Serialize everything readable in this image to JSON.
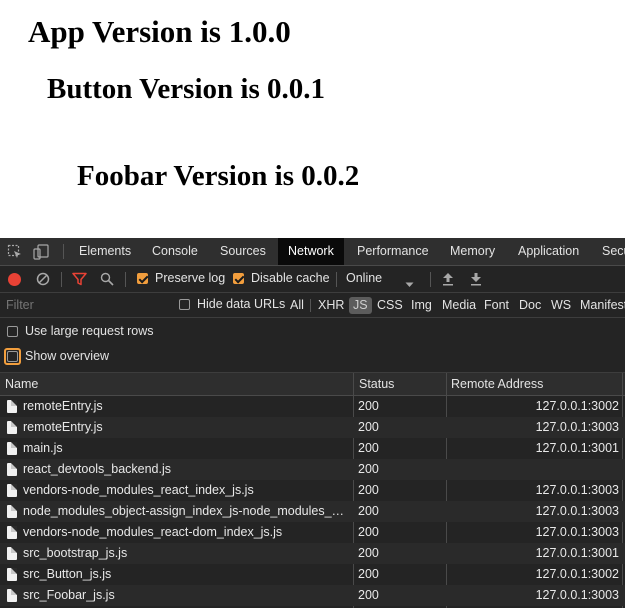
{
  "page": {
    "app_heading": "App Version is 1.0.0",
    "button_heading": "Button Version is 0.0.1",
    "foobar_heading": "Foobar Version is 0.0.2"
  },
  "devtools": {
    "tabs": [
      "Elements",
      "Console",
      "Sources",
      "Network",
      "Performance",
      "Memory",
      "Application",
      "Secu"
    ],
    "active_tab": "Network",
    "toolbar": {
      "preserve_log": {
        "label": "Preserve log",
        "checked": true
      },
      "disable_cache": {
        "label": "Disable cache",
        "checked": true
      },
      "throttling": "Online"
    },
    "filter": {
      "placeholder": "Filter",
      "hide_data_urls": {
        "label": "Hide data URLs",
        "checked": false
      },
      "types": [
        "All",
        "XHR",
        "JS",
        "CSS",
        "Img",
        "Media",
        "Font",
        "Doc",
        "WS",
        "Manifest"
      ],
      "active_type": "JS"
    },
    "options": {
      "large_rows": {
        "label": "Use large request rows",
        "checked": false
      },
      "show_overview": {
        "label": "Show overview",
        "checked": false
      }
    },
    "columns": {
      "name": "Name",
      "status": "Status",
      "remote": "Remote Address"
    },
    "rows": [
      {
        "name": "remoteEntry.js",
        "status": "200",
        "remote": "127.0.0.1:3002"
      },
      {
        "name": "remoteEntry.js",
        "status": "200",
        "remote": "127.0.0.1:3003"
      },
      {
        "name": "main.js",
        "status": "200",
        "remote": "127.0.0.1:3001"
      },
      {
        "name": "react_devtools_backend.js",
        "status": "200",
        "remote": ""
      },
      {
        "name": "vendors-node_modules_react_index_js.js",
        "status": "200",
        "remote": "127.0.0.1:3003"
      },
      {
        "name": "node_modules_object-assign_index_js-node_modules_pr…",
        "status": "200",
        "remote": "127.0.0.1:3003"
      },
      {
        "name": "vendors-node_modules_react-dom_index_js.js",
        "status": "200",
        "remote": "127.0.0.1:3003"
      },
      {
        "name": "src_bootstrap_js.js",
        "status": "200",
        "remote": "127.0.0.1:3001"
      },
      {
        "name": "src_Button_js.js",
        "status": "200",
        "remote": "127.0.0.1:3002"
      },
      {
        "name": "src_Foobar_js.js",
        "status": "200",
        "remote": "127.0.0.1:3003"
      }
    ],
    "colors": {
      "record": "#e94235",
      "filter_icon": "#e94235",
      "checkbox_checked": "#f29e3d",
      "focus_ring": "#f29e3d"
    },
    "icons": [
      "inspect-element-icon",
      "device-toolbar-icon",
      "record-icon",
      "clear-icon",
      "filter-icon",
      "search-icon",
      "dropdown-arrow-icon",
      "import-har-icon",
      "export-har-icon",
      "file-icon"
    ]
  }
}
